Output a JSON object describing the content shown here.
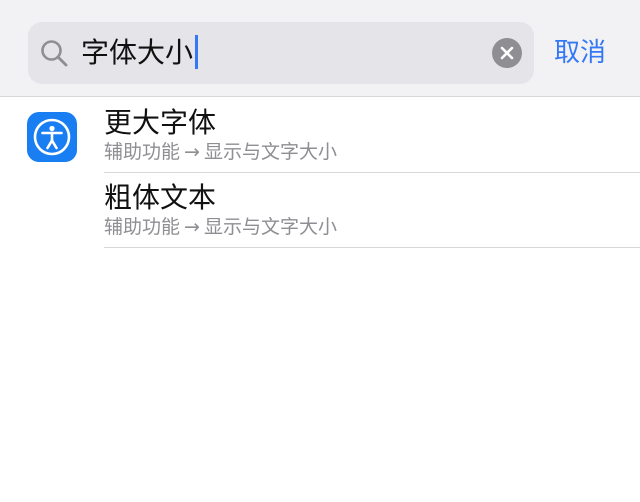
{
  "search": {
    "query": "字体大小",
    "cancel_label": "取消"
  },
  "results": [
    {
      "title": "更大字体",
      "path_from": "辅助功能",
      "path_arrow": "→",
      "path_to": "显示与文字大小"
    },
    {
      "title": "粗体文本",
      "path_from": "辅助功能",
      "path_arrow": "→",
      "path_to": "显示与文字大小"
    }
  ],
  "icons": {
    "search": "search-icon",
    "clear": "clear-icon",
    "app": "accessibility-icon"
  },
  "colors": {
    "accent": "#3478f6",
    "app_icon_bg": "#1a7ef3",
    "secondary_text": "#8e8e93"
  }
}
